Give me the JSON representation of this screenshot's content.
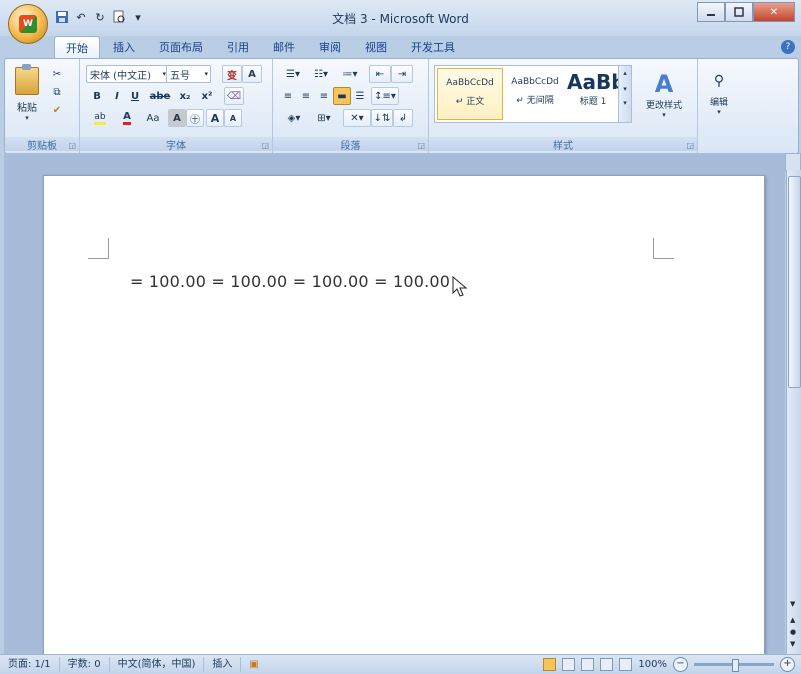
{
  "window": {
    "title": "文档 3 - Microsoft Word",
    "min_icon": "minimize-icon",
    "max_icon": "maximize-icon",
    "close_label": "✕"
  },
  "office_button": {
    "label": "W"
  },
  "quick_access": {
    "save_icon": "save-icon",
    "undo_icon": "undo-icon",
    "redo_icon": "redo-icon",
    "preview_icon": "print-preview-icon"
  },
  "tabs": [
    {
      "label": "开始",
      "active": true
    },
    {
      "label": "插入"
    },
    {
      "label": "页面布局"
    },
    {
      "label": "引用"
    },
    {
      "label": "邮件"
    },
    {
      "label": "审阅"
    },
    {
      "label": "视图"
    },
    {
      "label": "开发工具"
    }
  ],
  "ribbon": {
    "clipboard": {
      "label": "剪贴板",
      "paste": "粘贴"
    },
    "font": {
      "label": "字体",
      "font_name": "宋体 (中文正)",
      "font_size": "五号",
      "change_case": "变",
      "char_border": "A",
      "bold": "B",
      "italic": "I",
      "underline": "U",
      "strike": "abe",
      "subscript": "x₂",
      "superscript": "x²",
      "clear": "⌫",
      "highlight": "ab",
      "font_color": "A",
      "aa": "Aa",
      "char_shading": "A",
      "enclose": "㊉",
      "grow": "A",
      "shrink": "A"
    },
    "paragraph": {
      "label": "段落"
    },
    "styles": {
      "label": "样式",
      "items": [
        {
          "sample": "AaBbCcDd",
          "name": "↵ 正文"
        },
        {
          "sample": "AaBbCcDd",
          "name": "↵ 无间隔"
        },
        {
          "sample": "AaBb",
          "name": "标题 1"
        }
      ],
      "change_styles": "更改样式"
    },
    "editing": {
      "label": "编辑"
    }
  },
  "document": {
    "text": "= 100.00 = 100.00 = 100.00 = 100.00"
  },
  "statusbar": {
    "page": "页面: 1/1",
    "words": "字数: 0",
    "language": "中文(简体，中国)",
    "mode": "插入",
    "zoom": "100%"
  },
  "colors": {
    "ribbon_bg": "#d9e6f5",
    "tab_text": "#15428b",
    "status_bg": "#c3d4ea",
    "highlight": "#f5c55d"
  }
}
